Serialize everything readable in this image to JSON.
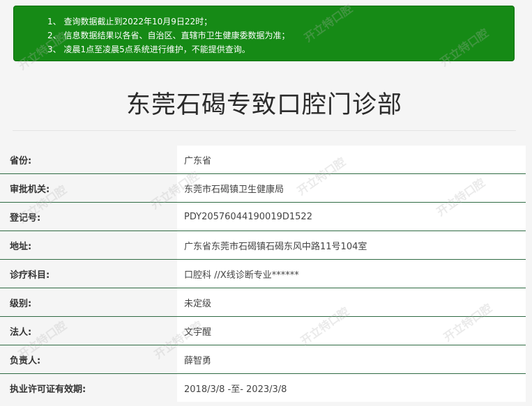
{
  "notice": {
    "lines": [
      "1、 查询数据截止到2022年10月9日22时；",
      "2、 信息数据结果以各省、自治区、直辖市卫生健康委数据为准；",
      "3、 凌晨1点至凌晨5点系统进行维护，不能提供查询。"
    ]
  },
  "page": {
    "title": "东莞石碣专致口腔门诊部"
  },
  "table": {
    "rows": [
      {
        "label": "省份:",
        "value": "广东省"
      },
      {
        "label": "审批机关:",
        "value": "东莞市石碣镇卫生健康局"
      },
      {
        "label": "登记号:",
        "value": "PDY20576044190019D1522"
      },
      {
        "label": "地址:",
        "value": "广东省东莞市石碣镇石碣东风中路11号104室"
      },
      {
        "label": "诊疗科目:",
        "value": "口腔科 //X线诊断专业******"
      },
      {
        "label": "级别:",
        "value": "未定级"
      },
      {
        "label": "法人:",
        "value": "文宇醒"
      },
      {
        "label": "负责人:",
        "value": "薛智勇"
      },
      {
        "label": "执业许可证有效期:",
        "value": "2018/3/8 -至- 2023/3/8"
      }
    ]
  },
  "watermark": {
    "text": "开立特口腔"
  }
}
